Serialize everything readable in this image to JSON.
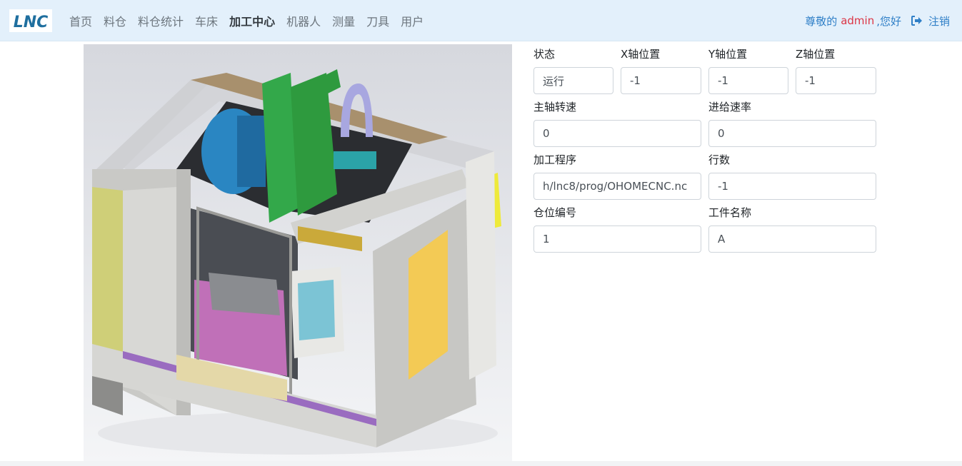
{
  "nav": {
    "logo_text": "LNC",
    "items": [
      {
        "label": "首页",
        "active": false
      },
      {
        "label": "料仓",
        "active": false
      },
      {
        "label": "料仓统计",
        "active": false
      },
      {
        "label": "车床",
        "active": false
      },
      {
        "label": "加工中心",
        "active": true
      },
      {
        "label": "机器人",
        "active": false
      },
      {
        "label": "测量",
        "active": false
      },
      {
        "label": "刀具",
        "active": false
      },
      {
        "label": "用户",
        "active": false
      }
    ],
    "greeting_prefix": "尊敬的",
    "username": "admin",
    "greeting_suffix": ",您好",
    "logout_label": "注销",
    "logout_icon": "sign-out-icon"
  },
  "status": {
    "state_label": "状态",
    "state_value": "运行",
    "x_label": "X轴位置",
    "x_value": "-1",
    "y_label": "Y轴位置",
    "y_value": "-1",
    "z_label": "Z轴位置",
    "z_value": "-1",
    "spindle_label": "主轴转速",
    "spindle_value": "0",
    "feed_label": "进给速率",
    "feed_value": "0",
    "program_label": "加工程序",
    "program_value": "h/lnc8/prog/OHOMECNC.nc",
    "lines_label": "行数",
    "lines_value": "-1",
    "slot_label": "仓位编号",
    "slot_value": "1",
    "part_label": "工件名称",
    "part_value": "A"
  },
  "colors": {
    "navbar_bg": "#e3f0fb",
    "logo_blue": "#1f6f9f",
    "link_blue": "#2f7fc7",
    "username_red": "#dc3545"
  }
}
